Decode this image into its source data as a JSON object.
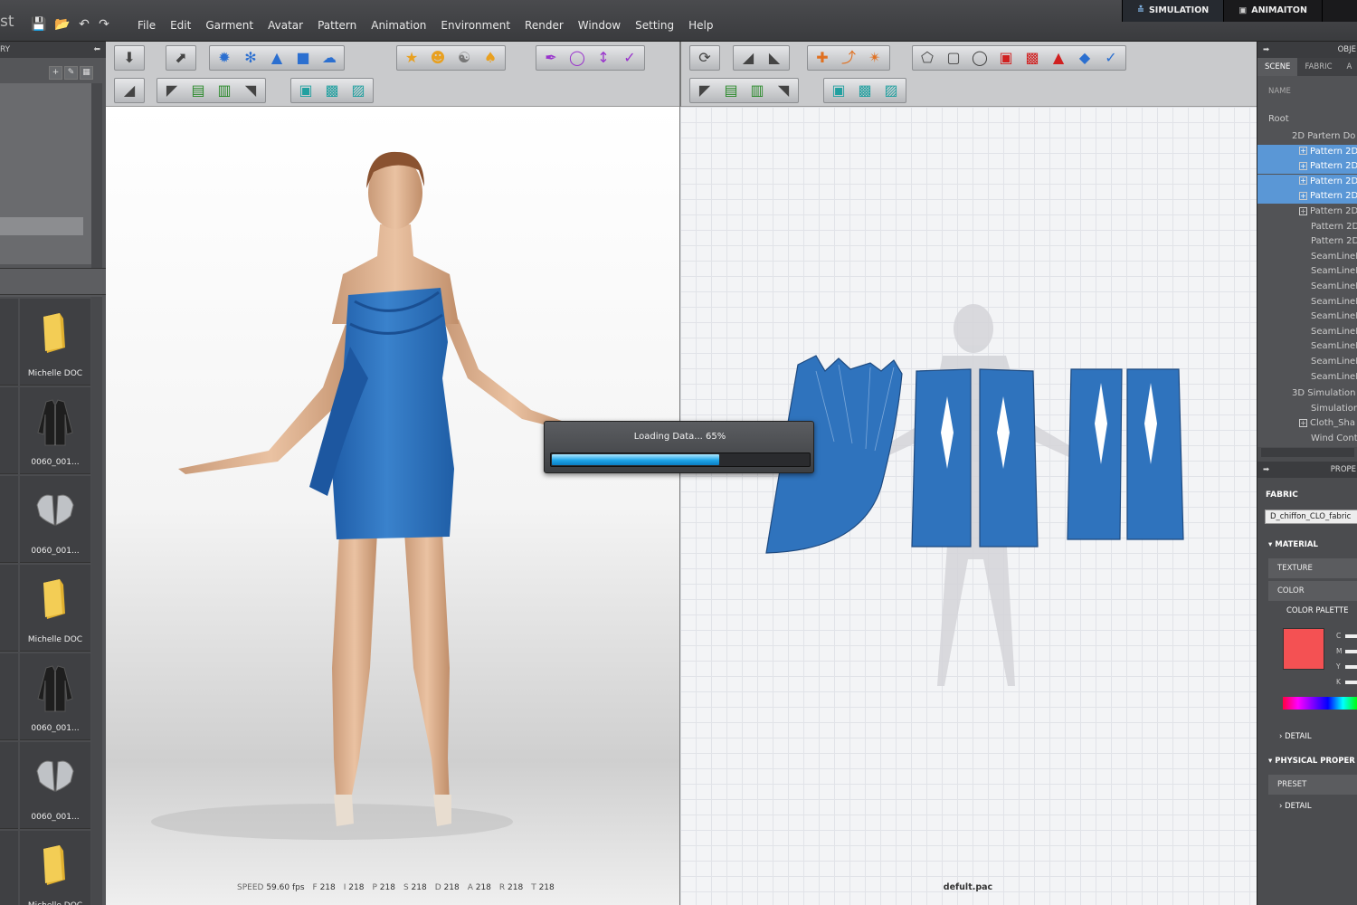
{
  "app": {
    "title_fragment": "st"
  },
  "menu": [
    "File",
    "Edit",
    "Garment",
    "Avatar",
    "Pattern",
    "Animation",
    "Environment",
    "Render",
    "Window",
    "Setting",
    "Help"
  ],
  "modes": {
    "simulation": "SIMULATION",
    "animation": "ANIMAITON"
  },
  "library": {
    "header": "RY",
    "items": [
      {
        "label": "Michelle DOC",
        "icon": "folder-icon"
      },
      {
        "label": "0060_001...",
        "icon": "jacket-icon"
      },
      {
        "label": "0060_001...",
        "icon": "shoulder-pads-icon"
      },
      {
        "label": "Michelle DOC",
        "icon": "folder-icon"
      },
      {
        "label": "0060_001...",
        "icon": "jacket-icon"
      },
      {
        "label": "0060_001...",
        "icon": "shoulder-pads-icon"
      },
      {
        "label": "Michelle DOC",
        "icon": "folder-icon"
      }
    ]
  },
  "viewport3d": {
    "stats": [
      {
        "k": "SPEED",
        "v": "59.60 fps"
      },
      {
        "k": "F",
        "v": "218"
      },
      {
        "k": "I",
        "v": "218"
      },
      {
        "k": "P",
        "v": "218"
      },
      {
        "k": "S",
        "v": "218"
      },
      {
        "k": "D",
        "v": "218"
      },
      {
        "k": "A",
        "v": "218"
      },
      {
        "k": "R",
        "v": "218"
      },
      {
        "k": "T",
        "v": "218"
      }
    ]
  },
  "viewport2d": {
    "filename": "defult.pac"
  },
  "loading": {
    "text": "Loading Data... 65%",
    "progress": 0.65
  },
  "object_panel": {
    "header": "OBJE",
    "tabs": [
      "SCENE",
      "FABRIC",
      "A"
    ],
    "name_column": "NAME",
    "tree": [
      {
        "label": "Root",
        "indent": 0,
        "selected": false,
        "box": false
      },
      {
        "label": "2D Partern Do",
        "indent": 1,
        "selected": false,
        "box": false
      },
      {
        "label": "Pattern 2D",
        "indent": 2,
        "selected": true,
        "box": true
      },
      {
        "label": "Pattern 2D",
        "indent": 2,
        "selected": true,
        "box": true
      },
      {
        "label": "Pattern 2D",
        "indent": 2,
        "selected": true,
        "box": true
      },
      {
        "label": "Pattern 2D",
        "indent": 2,
        "selected": true,
        "box": true
      },
      {
        "label": "Pattern 2D",
        "indent": 2,
        "selected": false,
        "box": true
      },
      {
        "label": "Pattern 2D",
        "indent": 2,
        "selected": false,
        "box": false
      },
      {
        "label": "Pattern 2D",
        "indent": 2,
        "selected": false,
        "box": false
      },
      {
        "label": "SeamLineP",
        "indent": 2,
        "selected": false,
        "box": false
      },
      {
        "label": "SeamLineP",
        "indent": 2,
        "selected": false,
        "box": false
      },
      {
        "label": "SeamLineP",
        "indent": 2,
        "selected": false,
        "box": false
      },
      {
        "label": "SeamLineP",
        "indent": 2,
        "selected": false,
        "box": false
      },
      {
        "label": "SeamLineP",
        "indent": 2,
        "selected": false,
        "box": false
      },
      {
        "label": "SeamLineP",
        "indent": 2,
        "selected": false,
        "box": false
      },
      {
        "label": "SeamLineP",
        "indent": 2,
        "selected": false,
        "box": false
      },
      {
        "label": "SeamLineP",
        "indent": 2,
        "selected": false,
        "box": false
      },
      {
        "label": "SeamLineP",
        "indent": 2,
        "selected": false,
        "box": false
      },
      {
        "label": "3D Simulation",
        "indent": 1,
        "selected": false,
        "box": false
      },
      {
        "label": "Simulation",
        "indent": 2,
        "selected": false,
        "box": false
      },
      {
        "label": "Cloth_Sha",
        "indent": 2,
        "selected": false,
        "box": true
      },
      {
        "label": "Wind Cont",
        "indent": 2,
        "selected": false,
        "box": false
      }
    ]
  },
  "property_panel": {
    "header": "PROPE",
    "fabric_title": "FABRIC",
    "fabric_value": "D_chiffon_CLO_fabric",
    "material": "MATERIAL",
    "texture": "TEXTURE",
    "color": "COLOR",
    "color_palette": "COLOR PALETTE",
    "cmyk": [
      "C",
      "M",
      "Y",
      "K"
    ],
    "swatch_color": "#f45153",
    "detail": "DETAIL",
    "physical": "PHYSICAL PROPER",
    "preset": "PRESET",
    "detail2": "DETAIL"
  },
  "colors": {
    "garment": "#2f73bd",
    "selection": "#5a97d6",
    "accent": "#1ea4e8"
  }
}
